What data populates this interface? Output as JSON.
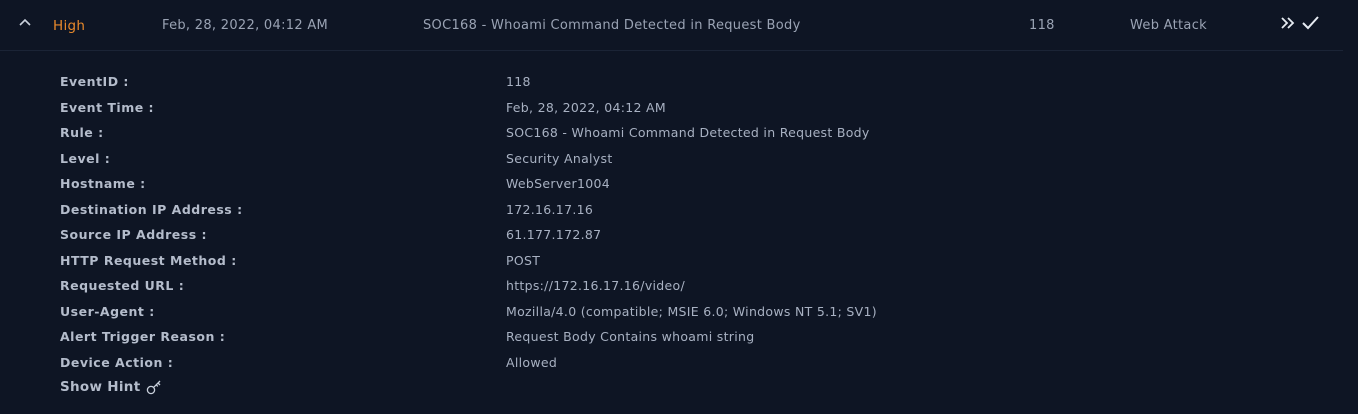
{
  "header": {
    "level": "High",
    "date": "Feb, 28, 2022, 04:12 AM",
    "rule": "SOC168 - Whoami Command Detected in Request Body",
    "event_id": "118",
    "type": "Web Attack",
    "collapse_icon": "chevron-up-icon",
    "forward_icon": "double-chevron-right-icon",
    "check_icon": "check-icon"
  },
  "details": [
    {
      "label": "EventID :",
      "value": "118"
    },
    {
      "label": "Event Time :",
      "value": "Feb, 28, 2022, 04:12 AM"
    },
    {
      "label": "Rule :",
      "value": "SOC168 - Whoami Command Detected in Request Body"
    },
    {
      "label": "Level :",
      "value": "Security Analyst"
    },
    {
      "label": "Hostname :",
      "value": "WebServer1004"
    },
    {
      "label": "Destination IP Address :",
      "value": "172.16.17.16"
    },
    {
      "label": "Source IP Address :",
      "value": "61.177.172.87"
    },
    {
      "label": "HTTP Request Method :",
      "value": "POST"
    },
    {
      "label": "Requested URL :",
      "value": "https://172.16.17.16/video/"
    },
    {
      "label": "User-Agent :",
      "value": "Mozilla/4.0 (compatible; MSIE 6.0; Windows NT 5.1; SV1)"
    },
    {
      "label": "Alert Trigger Reason :",
      "value": "Request Body Contains whoami string"
    },
    {
      "label": "Device Action :",
      "value": "Allowed"
    }
  ],
  "hint": {
    "label": "Show Hint",
    "icon": "key-icon"
  },
  "colors": {
    "background": "#0e1524",
    "level_high": "#e8892b",
    "text": "#a8b1c2",
    "label": "#b4bccb"
  }
}
